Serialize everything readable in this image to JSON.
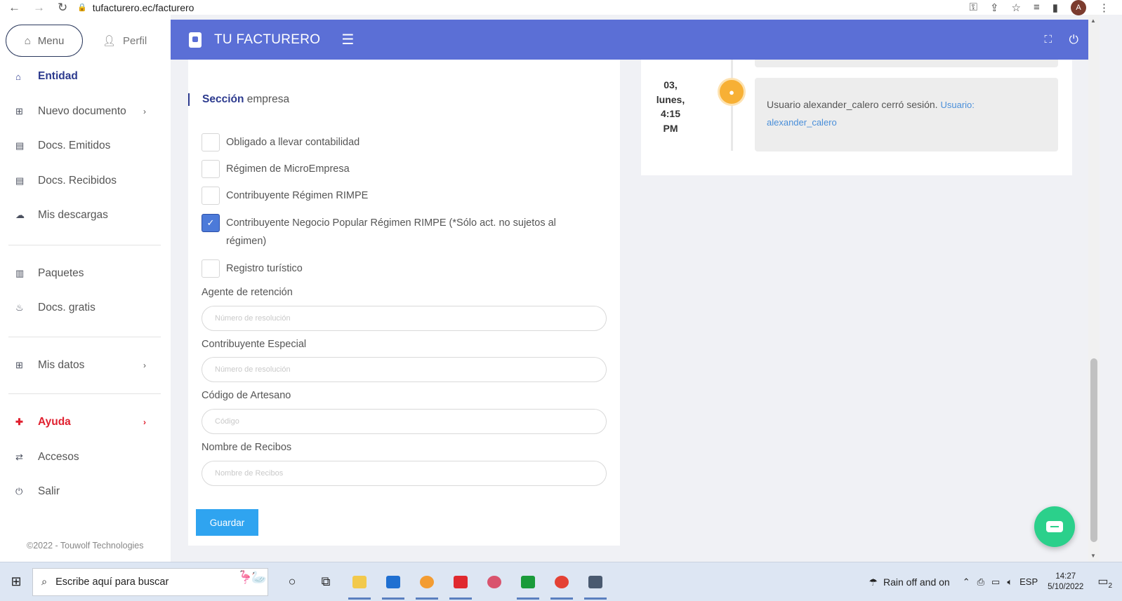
{
  "browser": {
    "url": "tufacturero.ec/facturero",
    "avatar_letter": "A"
  },
  "sidebar": {
    "tabs": {
      "menu": "Menu",
      "profile": "Perfil"
    },
    "items": [
      {
        "label": "Entidad"
      },
      {
        "label": "Nuevo documento"
      },
      {
        "label": "Docs. Emitidos"
      },
      {
        "label": "Docs. Recibidos"
      },
      {
        "label": "Mis descargas"
      },
      {
        "label": "Paquetes"
      },
      {
        "label": "Docs. gratis"
      },
      {
        "label": "Mis datos"
      },
      {
        "label": "Ayuda"
      },
      {
        "label": "Accesos"
      },
      {
        "label": "Salir"
      }
    ],
    "footer": "©2022 - Touwolf Technologies"
  },
  "header": {
    "brand": "TU FACTURERO"
  },
  "form": {
    "section_bold": "Sección",
    "section_rest": " empresa",
    "checkboxes": [
      {
        "label": "Obligado a llevar contabilidad",
        "checked": false
      },
      {
        "label": "Régimen de MicroEmpresa",
        "checked": false
      },
      {
        "label": "Contribuyente Régimen RIMPE",
        "checked": false
      },
      {
        "label": "Contribuyente Negocio Popular Régimen RIMPE (*Sólo act. no sujetos al régimen)",
        "checked": true
      },
      {
        "label": "Registro turístico",
        "checked": false
      }
    ],
    "fields": [
      {
        "label": "Agente de retención",
        "placeholder": "Número de resolución",
        "value": ""
      },
      {
        "label": "Contribuyente Especial",
        "placeholder": "Número de resolución",
        "value": ""
      },
      {
        "label": "Código de Artesano",
        "placeholder": "Código",
        "value": ""
      },
      {
        "label": "Nombre de Recibos",
        "placeholder": "Nombre de Recibos",
        "value": ""
      }
    ],
    "save_label": "Guardar"
  },
  "timeline": {
    "date_day": "03,",
    "date_weekday": "lunes,",
    "date_time": "4:15",
    "date_ampm": "PM",
    "message": "Usuario alexander_calero cerró sesión.",
    "link_prefix": "Usuario:",
    "link_user": "alexander_calero"
  },
  "taskbar": {
    "search_placeholder": "Escribe aquí para buscar",
    "weather": "Rain off and on",
    "language": "ESP",
    "time": "14:27",
    "date": "5/10/2022",
    "notifications": "2"
  },
  "colors": {
    "header_bg": "#5b6fd6",
    "primary_text": "#2c3a8e",
    "help_red": "#e0202f",
    "save_button": "#2fa4f0",
    "timeline_dot": "#f7b035",
    "chat_fab": "#2bd08b"
  }
}
